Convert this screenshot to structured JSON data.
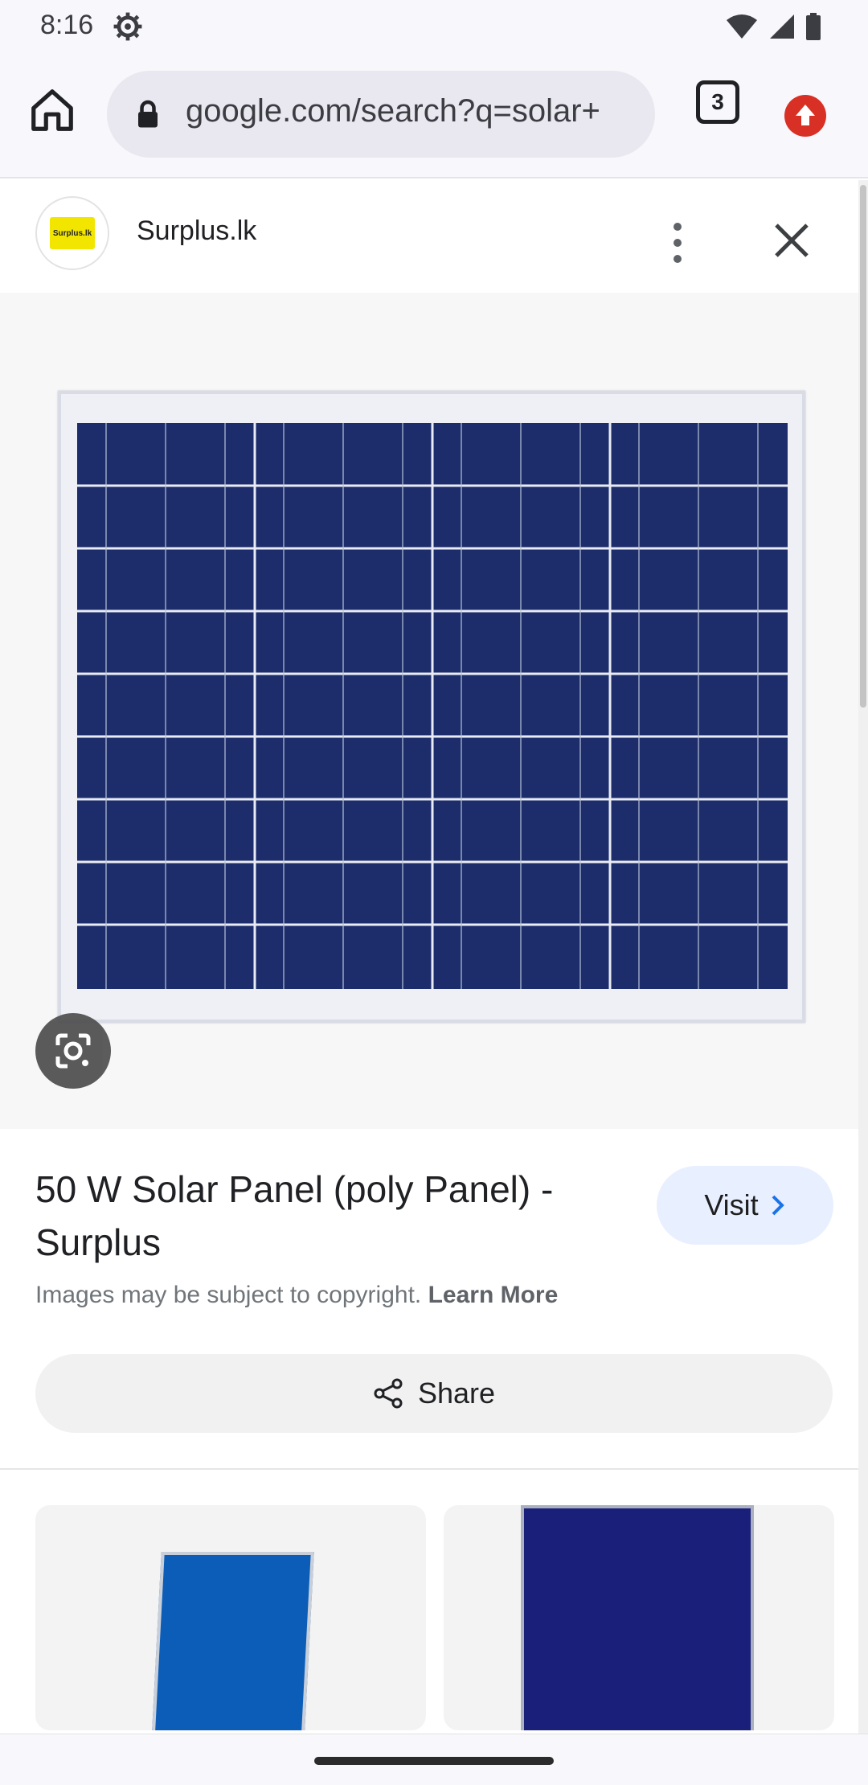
{
  "status_bar": {
    "time": "8:16"
  },
  "browser": {
    "url": "google.com/search?q=solar+",
    "tab_count": "3"
  },
  "source": {
    "name": "Surplus.lk",
    "logo_text": "Surplus.lk"
  },
  "result": {
    "title": "50 W Solar Panel (poly Panel) - Surplus",
    "visit_label": "Visit",
    "copyright_text": "Images may be subject to copyright.",
    "learn_more": "Learn More",
    "share_label": "Share"
  },
  "colors": {
    "accent": "#e8efff",
    "panel_blue": "#1d2d6b",
    "update_red": "#d93025"
  }
}
